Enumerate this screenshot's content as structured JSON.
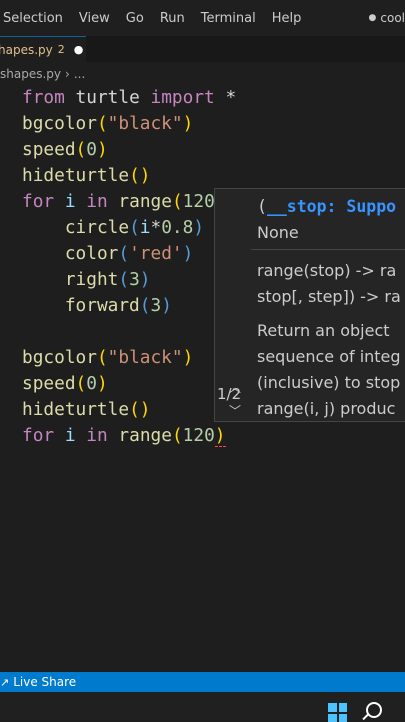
{
  "menubar": {
    "items": [
      "Selection",
      "View",
      "Go",
      "Run",
      "Terminal",
      "Help"
    ],
    "title_right": "cool"
  },
  "tab": {
    "name": "hapes.py",
    "problems": "2"
  },
  "breadcrumb": {
    "file": "shapes.py",
    "more": "..."
  },
  "code": {
    "l1": {
      "from": "from",
      "module": "turtle",
      "import": "import",
      "star": "*"
    },
    "l2": {
      "fn": "bgcolor",
      "arg": "\"black\""
    },
    "l3": {
      "fn": "speed",
      "arg": "0"
    },
    "l4": {
      "fn": "hideturtle"
    },
    "l5": {
      "for": "for",
      "var": "i",
      "in": "in",
      "fn": "range",
      "arg": "120"
    },
    "l6": {
      "fn": "circle",
      "var": "i",
      "op": "*",
      "num": "0.8"
    },
    "l7": {
      "fn": "color",
      "arg": "'red'"
    },
    "l8": {
      "fn": "right",
      "arg": "3"
    },
    "l9": {
      "fn": "forward",
      "arg": "3"
    },
    "l11": {
      "fn": "bgcolor",
      "arg": "\"black\""
    },
    "l12": {
      "fn": "speed",
      "arg": "0"
    },
    "l13": {
      "fn": "hideturtle"
    },
    "l14": {
      "for": "for",
      "var": "i",
      "in": "in",
      "fn": "range",
      "arg": "120"
    }
  },
  "signature_popup": {
    "param": "__stop: Suppo",
    "none": "None",
    "doc_lines": [
      "range(stop) -> ra",
      "stop[, step]) -> ra",
      "Return an object",
      "sequence of integ",
      "(inclusive) to stop",
      "range(i, j) produc"
    ],
    "counter": "1/2"
  },
  "statusbar": {
    "live_share": "Live Share"
  },
  "colors": {
    "accent": "#007acc",
    "keyword": "#c586c0",
    "function": "#dcdcaa",
    "string": "#ce9178",
    "number": "#b5cea8"
  }
}
